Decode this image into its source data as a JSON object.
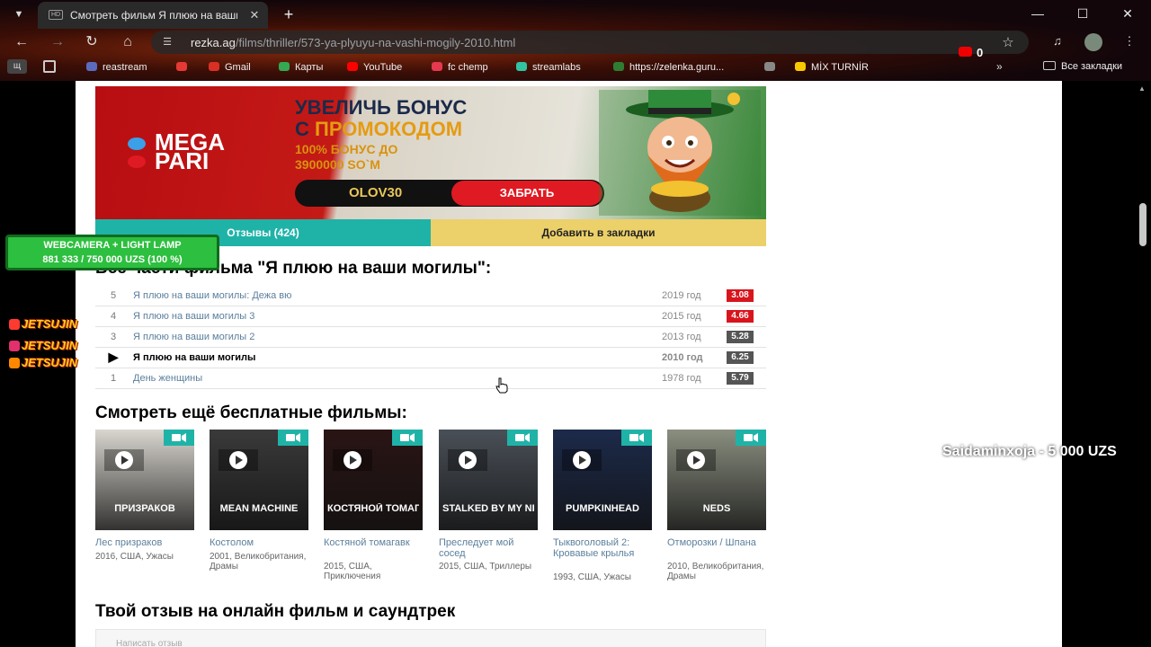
{
  "browser": {
    "tab_title": "Смотреть фильм Я плюю на ваши могилы",
    "tab_favicon": "HD",
    "url_host": "rezka.ag",
    "url_path": "/films/thriller/573-ya-plyuyu-na-vashi-mogily-2010.html",
    "ext_badge_count": "0",
    "ime_label": "щ",
    "bookmarks": [
      {
        "label": "reastream",
        "color": "#5c6bc0"
      },
      {
        "label": "",
        "color": "#e53935"
      },
      {
        "label": "Gmail",
        "color": "#d93025"
      },
      {
        "label": "Карты",
        "color": "#34a853"
      },
      {
        "label": "YouTube",
        "color": "#ff0000"
      },
      {
        "label": "fc chemp",
        "color": "#e53950"
      },
      {
        "label": "streamlabs",
        "color": "#31c3a2"
      },
      {
        "label": "https://zelenka.guru...",
        "color": "#2e7d32"
      },
      {
        "label": "",
        "color": "#888888"
      },
      {
        "label": "MİX TURNİR",
        "color": "#f9c900"
      }
    ],
    "all_bookmarks_label": "Все закладки"
  },
  "banner": {
    "logo": "MEGA PARI",
    "headline_line1": "УВЕЛИЧЬ БОНУС",
    "headline_line2_a": "С ",
    "headline_line2_b": "ПРОМОКОДОМ",
    "sub_line1": "100% БОНУС ДО",
    "sub_line2": "3900000 SO`M",
    "promo_code": "OLOV30",
    "cta": "ЗАБРАТЬ"
  },
  "tabs": {
    "reviews": "Отзывы (424)",
    "bookmark": "Добавить в закладки"
  },
  "franchise": {
    "title": "Все части фильма \"Я плюю на ваши могилы\":",
    "items": [
      {
        "num": "5",
        "title": "Я плюю на ваши могилы: Дежа вю",
        "year": "2019 год",
        "rating": "3.08",
        "rating_color": "#d8151d"
      },
      {
        "num": "4",
        "title": "Я плюю на ваши могилы 3",
        "year": "2015 год",
        "rating": "4.66",
        "rating_color": "#d8151d"
      },
      {
        "num": "3",
        "title": "Я плюю на ваши могилы 2",
        "year": "2013 год",
        "rating": "5.28",
        "rating_color": "#555555"
      },
      {
        "num": "▶",
        "title": "Я плюю на ваши могилы",
        "year": "2010 год",
        "rating": "6.25",
        "rating_color": "#555555"
      },
      {
        "num": "1",
        "title": "День женщины",
        "year": "1978 год",
        "rating": "5.79",
        "rating_color": "#555555"
      }
    ]
  },
  "more_title": "Смотреть ещё бесплатные фильмы:",
  "cards": [
    {
      "title": "Лес призраков",
      "meta": "2016, США, Ужасы",
      "poster_text": "ПРИЗРАКОВ",
      "bg": "#d9d6cf"
    },
    {
      "title": "Костолом",
      "meta": "2001, Великобритания, Драмы",
      "poster_text": "MEAN MACHINE",
      "bg": "#3a3a3a"
    },
    {
      "title": "Костяной томагавк",
      "meta": "2015, США, Приключения",
      "poster_text": "КОСТЯНОЙ ТОМАГАВК",
      "bg": "#2a1414"
    },
    {
      "title": "Преследует мой сосед",
      "meta": "2015, США, Триллеры",
      "poster_text": "STALKED BY MY NEIGHBOR",
      "bg": "#4a5058"
    },
    {
      "title": "Тыквоголовый 2: Кровавые крылья",
      "meta": "1993, США, Ужасы",
      "poster_text": "PUMPKINHEAD",
      "bg": "#1c2a4a"
    },
    {
      "title": "Отморозки / Шпана",
      "meta": "2010, Великобритания, Драмы",
      "poster_text": "NEDS",
      "bg": "#8a8f80"
    }
  ],
  "comment": {
    "title": "Твой отзыв на онлайн фильм и саундтрек",
    "placeholder": "Написать отзыв"
  },
  "overlay": {
    "widget_line1": "WEBCAMERA + LIGHT LAMP",
    "widget_line2": "881 333 / 750 000 UZS (100 %)",
    "streamer": [
      "JETSUJIN",
      "JETSUJIN",
      "JETSUJIN"
    ],
    "streamer_icon_colors": [
      "#ff3b30",
      "#e1306c",
      "#ff8800"
    ],
    "donation": "Saidaminxoja - 5 000 UZS"
  }
}
